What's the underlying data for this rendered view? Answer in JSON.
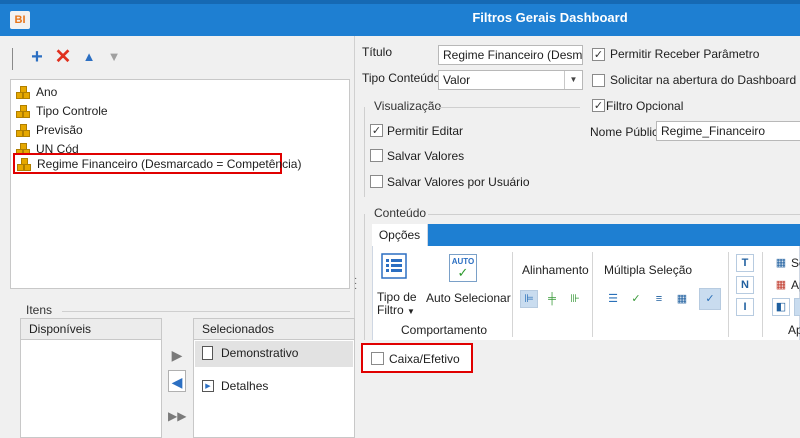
{
  "window": {
    "title": "Filtros Gerais Dashboard",
    "app_icon_text": "BI"
  },
  "toolbar": {
    "add_icon": "plus-icon",
    "delete_icon": "x-icon",
    "up_icon": "arrow-up-icon",
    "down_icon": "arrow-down-icon"
  },
  "tree": {
    "items": [
      {
        "label": "Ano"
      },
      {
        "label": "Tipo Controle"
      },
      {
        "label": "Previsão"
      },
      {
        "label": "UN Cód"
      },
      {
        "label": "Regime Financeiro (Desmarcado = Competência)",
        "selected": true
      }
    ]
  },
  "itens": {
    "group_label": "Itens",
    "available_header": "Disponíveis",
    "selected_header": "Selecionados",
    "selected_items": [
      {
        "label": "Demonstrativo"
      },
      {
        "label": "Detalhes"
      }
    ]
  },
  "form": {
    "titulo_label": "Título",
    "titulo_value": "Regime Financeiro (Desmarca",
    "tipo_conteudo_label": "Tipo Conteúdo",
    "tipo_conteudo_value": "Valor",
    "permitir_receber_parametro": "Permitir Receber Parâmetro",
    "solicitar_abertura": "Solicitar na abertura do Dashboard",
    "filtro_opcional": "Filtro Opcional",
    "nome_publico_label": "Nome Público",
    "nome_publico_value": "Regime_Financeiro"
  },
  "visualizacao": {
    "group_label": "Visualização",
    "permitir_editar": "Permitir Editar",
    "salvar_valores": "Salvar Valores",
    "salvar_valores_usuario": "Salvar Valores por Usuário"
  },
  "conteudo": {
    "group_label": "Conteúdo",
    "tab_label": "Opções",
    "tipo_filtro_label1": "Tipo de",
    "tipo_filtro_label2": "Filtro",
    "auto_selecionar_label": "Auto Selecionar",
    "auto_icon_text": "AUTO",
    "comportamento_label": "Comportamento",
    "alinhamento_label": "Alinhamento",
    "multipla_selecao_label": "Múltipla Seleção",
    "partial_se": "Se",
    "partial_ap": "Ap",
    "partial_ap2": "Ap",
    "fmt_t": "T",
    "fmt_n": "N",
    "fmt_i": "I"
  },
  "content_item": {
    "label": "Caixa/Efetivo"
  },
  "colors": {
    "titlebar": "#1e7fd2",
    "highlight": "#e00000",
    "tree_icon": "#e6a800"
  }
}
